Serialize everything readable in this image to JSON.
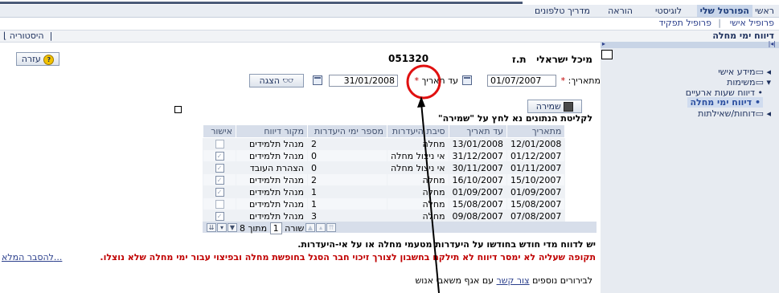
{
  "topnav": {
    "tabs": [
      "ראשי",
      "הפורטל שלי",
      "לוגיסטי",
      "הוראה",
      "מדריך טלפונים"
    ],
    "active_tab": "הפורטל שלי"
  },
  "subnav": {
    "items": [
      "פרופיל אישי",
      "פרופיל תפקיד"
    ],
    "separator": "|"
  },
  "page_title": "דיווח ימי מחלה",
  "history_label": "היסטוריה",
  "help_label": "עזרה",
  "employee": {
    "name": "מיכל ישראלי",
    "id_label": "ת.ז",
    "id_value": "051320"
  },
  "filters": {
    "from_label": "מתאריך:",
    "from_value": "01/07/2007",
    "to_label": "עד תאריך",
    "to_value": "31/01/2008",
    "required_mark": "*",
    "show_button": "הצגה"
  },
  "save_button": "שמירה",
  "save_hint": "לקליטת הנתונים נא לחץ על \"שמירה\"",
  "sidebar": {
    "items": [
      {
        "label": "מידע אישי",
        "prefix": "◂ ▭"
      },
      {
        "label": "משימות",
        "prefix": "▾ ▭"
      },
      {
        "label": "דיווח שעות ארעיים",
        "prefix": "•"
      },
      {
        "label": "דיווח ימי מחלה",
        "prefix": "•"
      },
      {
        "label": "דוחות/שאילתות",
        "prefix": "◂ ▭"
      }
    ],
    "selected": "דיווח ימי מחלה"
  },
  "table": {
    "headers": [
      "מתאריך",
      "עד תאריך",
      "סיבת היעדרות",
      "מספר ימי היעדרות",
      "מקור דיווח",
      "אישור"
    ],
    "rows": [
      {
        "from": "12/01/2008",
        "to": "13/01/2008",
        "reason": "מחלה",
        "days": "2",
        "source": "מנהל תלמידים",
        "approved": false
      },
      {
        "from": "01/12/2007",
        "to": "31/12/2007",
        "reason": "אי ניצול מחלה",
        "days": "0",
        "source": "מנהל תלמידים",
        "approved": true
      },
      {
        "from": "01/11/2007",
        "to": "30/11/2007",
        "reason": "אי ניצול מחלה",
        "days": "0",
        "source": "הצהרת העובד",
        "approved": true
      },
      {
        "from": "15/10/2007",
        "to": "16/10/2007",
        "reason": "מחלה",
        "days": "2",
        "source": "מנהל תלמידים",
        "approved": true
      },
      {
        "from": "01/09/2007",
        "to": "01/09/2007",
        "reason": "מחלה",
        "days": "1",
        "source": "מנהל תלמידים",
        "approved": true
      },
      {
        "from": "15/08/2007",
        "to": "15/08/2007",
        "reason": "מחלה",
        "days": "1",
        "source": "מנהל תלמידים",
        "approved": false
      },
      {
        "from": "07/08/2007",
        "to": "09/08/2007",
        "reason": "מחלה",
        "days": "3",
        "source": "מנהל תלמידים",
        "approved": true
      }
    ]
  },
  "pager": {
    "row_label": "שורה",
    "current": "1",
    "of_label": "מתוך",
    "total": "8"
  },
  "notes": {
    "line1": "יש לדווח מדי חודש בחודשו על היעדרות מטעמי מחלה או על אי-היעדרות.",
    "line2": "תקופה שעליה לא ימסר דיווח לא תילקח בחשבון לצורך זיכוי חבר הסגל בחופשת מחלה ובפיצוי עבור ימי מחלה שלא נוצלו.",
    "line2_link": "להסבר המלא...",
    "line3_pre": "לבירורים נוספים",
    "line3_link": "צור קשר",
    "line3_post": "עם אגף משאבי אנוש"
  },
  "colors": {
    "accent": "#2b3f8c",
    "warning": "#c00000",
    "annotation": "#e01010"
  }
}
